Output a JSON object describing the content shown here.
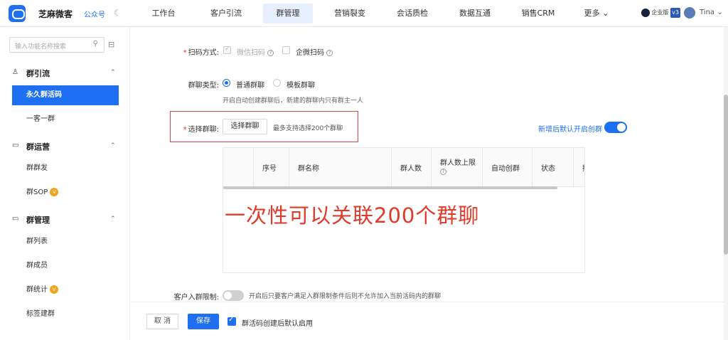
{
  "topbar": {
    "brand": "芝麻微客",
    "account_type": "公众号",
    "nav": [
      "工作台",
      "客户引流",
      "群管理",
      "营销裂变",
      "会话质检",
      "数据互通",
      "销售CRM",
      "更多 ⌄"
    ],
    "active_nav": "群管理",
    "edition": "企业版",
    "version": "v3",
    "user": "Tina ⌄"
  },
  "sidebar": {
    "search_placeholder": "输入功能名称搜索",
    "groups": [
      {
        "title": "群引流",
        "items": [
          "永久群活码",
          "一客一群"
        ]
      },
      {
        "title": "群运营",
        "items": [
          "群群发",
          "群SOP"
        ]
      },
      {
        "title": "群管理",
        "items": [
          "群列表",
          "群成员",
          "群统计",
          "标签建群"
        ]
      }
    ],
    "active_item": "永久群活码",
    "vip_mark": "V"
  },
  "form": {
    "scan_label": "扫码方式:",
    "scan_opt_wechat": "微信扫码",
    "scan_opt_wecom": "企微扫码",
    "type_label": "群聊类型:",
    "type_opt_normal": "普通群聊",
    "type_opt_template": "模板群聊",
    "type_hint": "开启自动创建群聊后，新建的群聊内只有群主一人",
    "select_label": "选择群聊:",
    "select_button": "选择群聊",
    "select_hint": "最多支持选择200个群聊",
    "auto_create_label": "新增后默认开启创群",
    "table_headers": [
      "",
      "序号",
      "群名称",
      "群人数",
      "群人数上限",
      "自动创群",
      "状态",
      "操"
    ],
    "annotation": "一次性可以关联200个群聊",
    "limit_label": "客户入群限制:",
    "limit_hint": "开启后只要客户满足入群限制条件后则不允许加入当前活码内的群聊"
  },
  "footer": {
    "cancel": "取 消",
    "save": "保存",
    "enable_label": "群活码创建后默认启用"
  },
  "colors": {
    "accent": "#1e6ff1",
    "annotation_red": "#e23a2a",
    "box_red": "#c94a42"
  }
}
